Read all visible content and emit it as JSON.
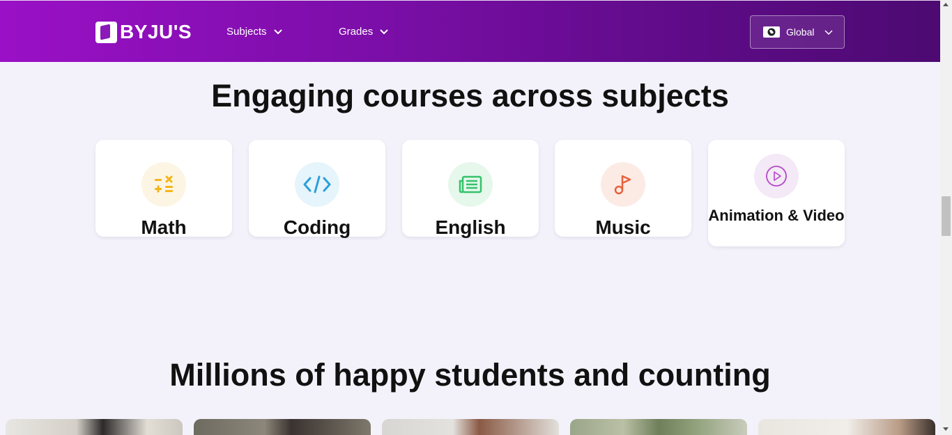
{
  "header": {
    "brand": "BYJU'S",
    "nav": [
      {
        "label": "Subjects"
      },
      {
        "label": "Grades"
      }
    ],
    "region": {
      "label": "Global",
      "icon": "globe-icon"
    }
  },
  "courses": {
    "title": "Engaging courses across subjects",
    "items": [
      {
        "label": "Math",
        "icon": "math-operators-icon",
        "color": "#f5b51b",
        "bg": "#fdf5e4"
      },
      {
        "label": "Coding",
        "icon": "code-icon",
        "color": "#2a9fd8",
        "bg": "#e6f4fb"
      },
      {
        "label": "English",
        "icon": "newspaper-icon",
        "color": "#34c26b",
        "bg": "#e6f7ec"
      },
      {
        "label": "Music",
        "icon": "music-note-icon",
        "color": "#e8613a",
        "bg": "#fcebe5"
      },
      {
        "label": "Animation & Video",
        "icon": "play-circle-icon",
        "color": "#b347c8",
        "bg": "#f4e9f6"
      }
    ]
  },
  "testimonials": {
    "title": "Millions of happy students and counting"
  },
  "colors": {
    "header_start": "#9a10c6",
    "header_end": "#4d0a72",
    "page_bg": "#f3f2fb"
  }
}
